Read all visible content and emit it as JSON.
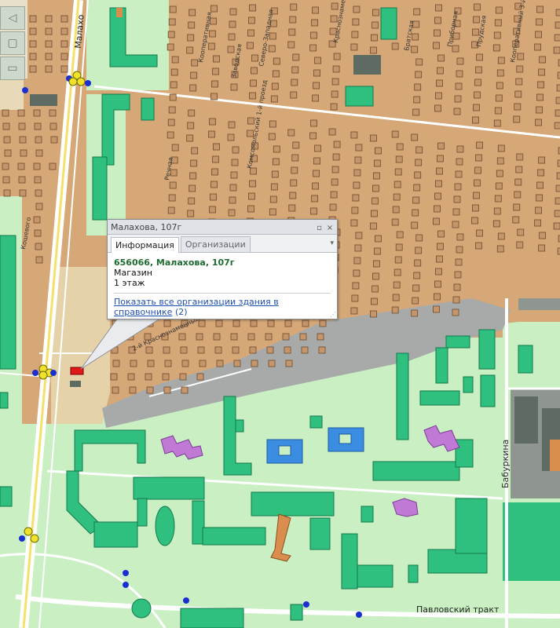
{
  "map": {
    "streets": {
      "malakhova_top": "Малахо",
      "kosheva": "Кошевого",
      "baburkina": "Бабуркина",
      "pavlovsky": "Павловский тракт",
      "krasnoznamenny": "2-й Краснознаменный пр.",
      "small": [
        "Кооперативная",
        "Заводская",
        "Северо-Западная",
        "Краснознаменный",
        "Братская",
        "Приборная",
        "Прудская",
        "Кооперативный 3-й проезд",
        "Речная",
        "Комсомольский 1-й проезд"
      ]
    },
    "colors": {
      "residential": "#d6a878",
      "park": "#c9efc3",
      "building_green": "#2fbf7e",
      "building_blue": "#3a8de0",
      "building_purple": "#c07ad6",
      "building_brown": "#d98e4e",
      "building_gray": "#5d6b63",
      "railway": "#9ea3a3",
      "road": "#ffffff",
      "main_road": "#f5e16a",
      "stop_blue": "#1a2fd0",
      "stop_yellow": "#f2e12a",
      "selected_building": "#e01a1a"
    },
    "selected_marker_icon": "selected-building-marker",
    "nav_icons": [
      "pan-icon",
      "zoom-icon",
      "layer-icon"
    ]
  },
  "popup": {
    "title": "Малахова, 107г",
    "minimize_icon": "minimize-icon",
    "close_icon": "close-icon",
    "tabs": [
      {
        "label": "Информация",
        "active": true
      },
      {
        "label": "Организации",
        "active": false
      }
    ],
    "address": "656066, Малахова, 107г",
    "type": "Магазин",
    "floors": "1 этаж",
    "link_text": "Показать все организации здания в справочнике",
    "link_count": "(2)"
  }
}
